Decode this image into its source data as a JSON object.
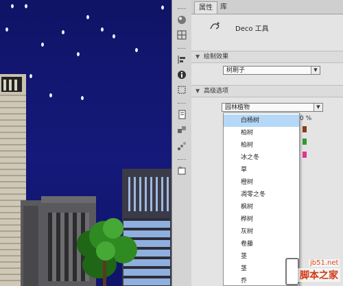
{
  "panel": {
    "tabs": [
      {
        "label": "属性"
      },
      {
        "label": "库"
      }
    ],
    "tool_title": "Deco 工具",
    "sections": {
      "drawing_effect": {
        "label": "绘制效果",
        "value": "树刷子"
      },
      "advanced_options": {
        "label": "高级选项",
        "value": "园林植物"
      }
    },
    "percent_text": "0 %",
    "swatch_colors": [
      "#8b3a1a",
      "#2f9a2f",
      "#e0358e"
    ]
  },
  "dropdown": {
    "items": [
      "白杨树",
      "柏树",
      "柏树",
      "冰之冬",
      "草",
      "橙树",
      "凋零之冬",
      "枫树",
      "桦树",
      "灰树",
      "卷藤",
      "茎",
      "茎",
      "乔"
    ],
    "selected_index": 0
  },
  "toolstrip": {
    "icons": [
      "brush-palette-icon",
      "grid-icon",
      "align-icon",
      "info-icon",
      "transform-icon",
      "history-icon",
      "components-icon",
      "motion-presets-icon",
      "library-icon"
    ]
  },
  "watermark": {
    "site": "jb51.net",
    "name": "脚本之家"
  },
  "colors": {
    "sky": "#14197a",
    "selected_row": "#b4d8f6",
    "panel_bg": "#e4e4e4"
  }
}
